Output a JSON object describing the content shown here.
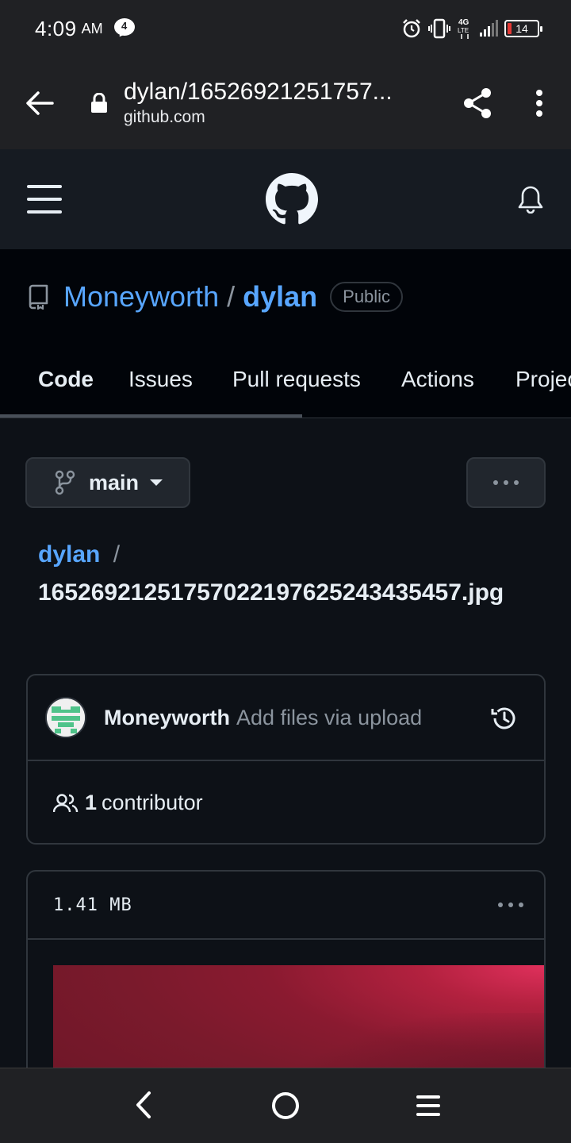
{
  "status_bar": {
    "time": "4:09",
    "ampm": "AM",
    "notification_count": "4",
    "battery": "14",
    "network": "4G LTE"
  },
  "browser": {
    "page_title": "dylan/16526921251757...",
    "domain": "github.com"
  },
  "repo": {
    "owner": "Moneyworth",
    "separator": "/",
    "name": "dylan",
    "visibility": "Public"
  },
  "tabs": [
    {
      "label": "Code"
    },
    {
      "label": "Issues"
    },
    {
      "label": "Pull requests"
    },
    {
      "label": "Actions"
    },
    {
      "label": "Projects"
    }
  ],
  "branch": {
    "label": "main"
  },
  "path": {
    "repo": "dylan",
    "separator": "/",
    "file": "1652692125175702219762524343545​7.jpg"
  },
  "commit": {
    "author": "Moneyworth",
    "message": "Add files via upload"
  },
  "contributors": {
    "count": "1",
    "label": "contributor"
  },
  "file": {
    "size": "1.41 MB"
  },
  "colors": {
    "link": "#58a6ff",
    "tab_underline": "#f78166",
    "background": "#0d1117"
  }
}
